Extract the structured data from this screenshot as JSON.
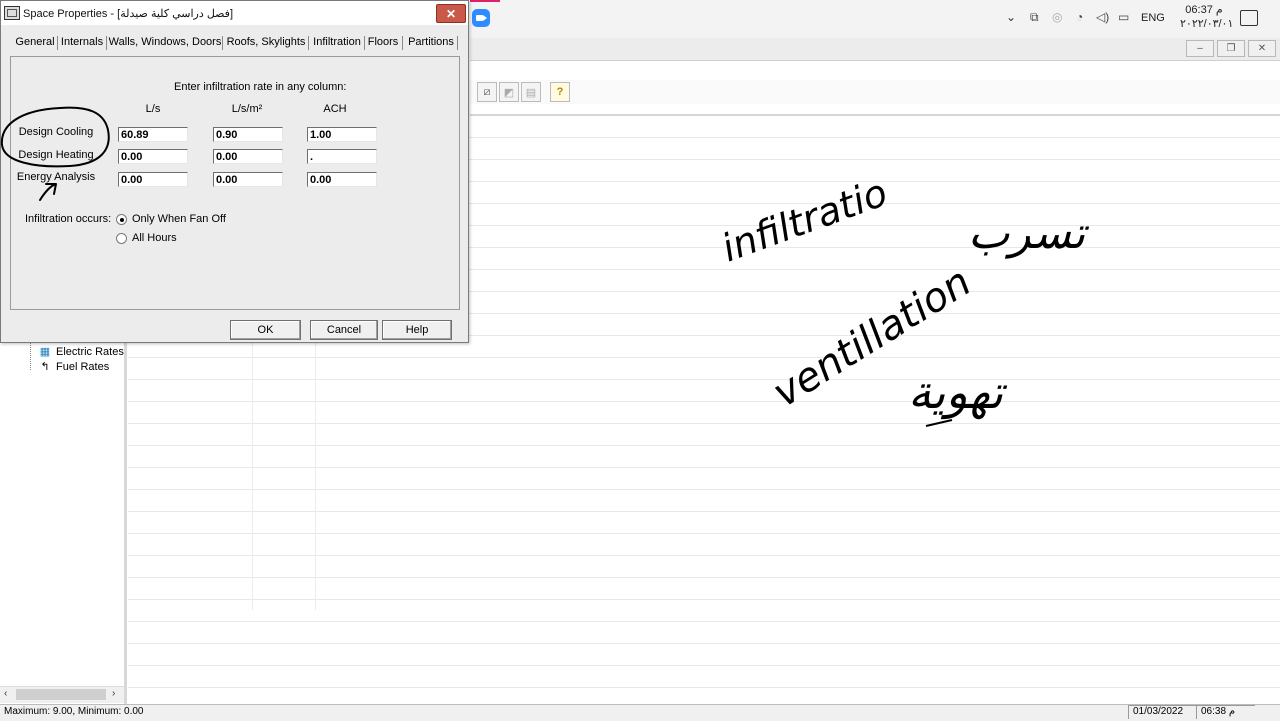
{
  "dialog": {
    "title": "Space Properties - [فصل دراسي كلية صيدلة]",
    "tabs": [
      "General",
      "Internals",
      "Walls, Windows, Doors",
      "Roofs, Skylights",
      "Infiltration",
      "Floors",
      "Partitions"
    ],
    "active_tab": "Infiltration",
    "instruction": "Enter infiltration rate in any column:",
    "columns": [
      "L/s",
      "L/s/m²",
      "ACH"
    ],
    "rows": [
      {
        "label": "Design Cooling",
        "values": [
          "60.89",
          "0.90",
          "1.00"
        ]
      },
      {
        "label": "Design Heating",
        "values": [
          "0.00",
          "0.00",
          "."
        ]
      },
      {
        "label": "Energy Analysis",
        "values": [
          "0.00",
          "0.00",
          "0.00"
        ]
      }
    ],
    "occurs_label": "Infiltration occurs:",
    "options": [
      {
        "label": "Only When Fan Off",
        "selected": true
      },
      {
        "label": "All Hours",
        "selected": false
      }
    ],
    "buttons": {
      "ok": "OK",
      "cancel": "Cancel",
      "help": "Help"
    },
    "close_glyph": "✕"
  },
  "tree": {
    "items": [
      {
        "label": "Electric Rates",
        "icon": "electric-rates-icon"
      },
      {
        "label": "Fuel Rates",
        "icon": "fuel-rates-icon"
      }
    ]
  },
  "taskbar": {
    "language": "ENG",
    "time": "06:37 م",
    "date": "٢٠٢٢/٠٣/٠١"
  },
  "statusbar": {
    "text": "Maximum: 9.00, Minimum: 0.00",
    "date": "01/03/2022",
    "time": "06:38 م"
  },
  "handwriting": {
    "words": [
      "infiltratio",
      "ventillation",
      "تسرب",
      "تهوية"
    ],
    "color": "#000000"
  },
  "colors": {
    "close_button": "#c95a4a",
    "zoom_blue": "#2d8cff"
  }
}
